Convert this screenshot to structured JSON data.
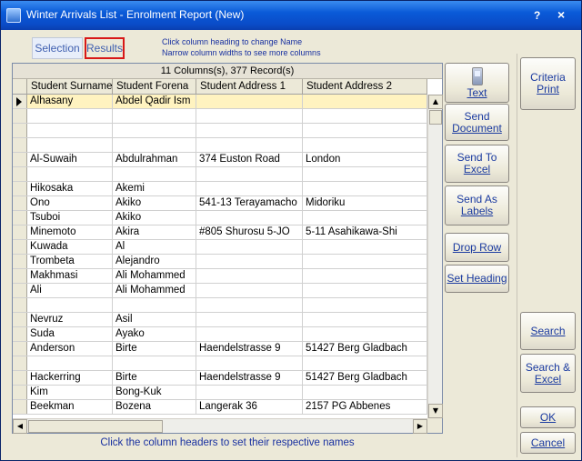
{
  "window": {
    "title": "Winter Arrivals List - Enrolment Report (New)",
    "help_label": "?",
    "close_label": "×"
  },
  "tabs": [
    {
      "label": "Selection"
    },
    {
      "label": "Results"
    }
  ],
  "hints": {
    "line1": "Click column heading to change Name",
    "line2": "Narrow column widths to see more columns"
  },
  "grid": {
    "caption": "11 Columns(s), 377 Record(s)",
    "columns": [
      "Student Surname",
      "Student Forena",
      "Student Address 1",
      "Student Address 2"
    ],
    "rows": [
      [
        "Alhasany",
        "Abdel Qadir Ism",
        "",
        ""
      ],
      [
        "",
        "",
        "",
        ""
      ],
      [
        "",
        "",
        "",
        ""
      ],
      [
        "",
        "",
        "",
        ""
      ],
      [
        "Al-Suwaih",
        "Abdulrahman",
        "374 Euston Road",
        "London"
      ],
      [
        "",
        "",
        "",
        ""
      ],
      [
        "Hikosaka",
        "Akemi",
        "",
        ""
      ],
      [
        "Ono",
        "Akiko",
        "541-13 Terayamacho",
        "Midoriku"
      ],
      [
        "Tsuboi",
        "Akiko",
        "",
        ""
      ],
      [
        "Minemoto",
        "Akira",
        "#805 Shurosu 5-JO",
        "5-11 Asahikawa-Shi"
      ],
      [
        "Kuwada",
        "Al",
        "",
        ""
      ],
      [
        "Trombeta",
        "Alejandro",
        "",
        ""
      ],
      [
        "Makhmasi",
        "Ali Mohammed",
        "",
        ""
      ],
      [
        "Ali",
        "Ali Mohammed",
        "",
        ""
      ],
      [
        "",
        "",
        "",
        ""
      ],
      [
        "Nevruz",
        "Asil",
        "",
        ""
      ],
      [
        "Suda",
        "Ayako",
        "",
        ""
      ],
      [
        "Anderson",
        "Birte",
        "Haendelstrasse 9",
        "51427 Berg Gladbach"
      ],
      [
        "",
        "",
        "",
        ""
      ],
      [
        "Hackerring",
        "Birte",
        "Haendelstrasse 9",
        "51427 Berg Gladbach"
      ],
      [
        "Kim",
        "Bong-Kuk",
        "",
        ""
      ],
      [
        "Beekman",
        "Bozena",
        "Langerak 36",
        "2157 PG Abbenes"
      ]
    ],
    "footer": "Click the column headers to set their respective names"
  },
  "buttons": {
    "text": "Text",
    "send_document_1": "Send",
    "send_document_2": "Document",
    "send_excel_1": "Send To",
    "send_excel_2": "Excel",
    "send_labels_1": "Send As",
    "send_labels_2": "Labels",
    "drop_row": "Drop Row",
    "set_heading": "Set Heading",
    "criteria_1": "Criteria",
    "criteria_2": "Print",
    "search": "Search",
    "search_excel_1": "Search &",
    "search_excel_2": "Excel",
    "ok": "OK",
    "cancel": "Cancel"
  },
  "icons": {
    "text_button_icon": "phone-icon",
    "scroll_up": "triangle-up-icon",
    "scroll_down": "triangle-down-icon",
    "scroll_left": "triangle-left-icon",
    "scroll_right": "triangle-right-icon",
    "selected_row_marker": "row-pointer-icon"
  }
}
